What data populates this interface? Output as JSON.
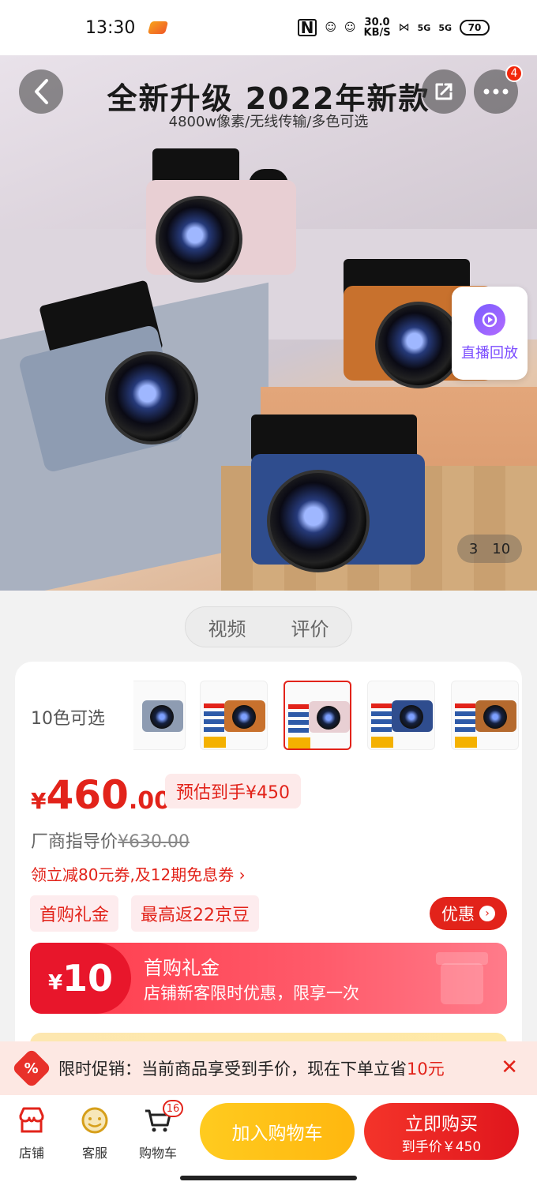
{
  "status_bar": {
    "time": "13:30",
    "nfc": "N",
    "net_speed_value": "30.0",
    "net_speed_unit": "KB/S",
    "signal1": "5G",
    "signal2": "5G",
    "battery": "70"
  },
  "hero": {
    "title": "全新升级  2022年新款",
    "subtitle": "4800w像素/无线传输/多色可选",
    "more_badge": "4",
    "live_replay_label": "直播回放",
    "pager_current": "3",
    "pager_total": "10"
  },
  "media_tabs": [
    "视频",
    "评价"
  ],
  "product": {
    "color_label": "10色可选",
    "price_currency": "¥",
    "price_int": "460",
    "price_dec": ".00",
    "estimate": "预估到手¥450",
    "msrp_label": "厂商指导价",
    "msrp_value": "¥630.00",
    "coupon_line": "领立减80元券,及12期免息券 ›",
    "chips": [
      "首购礼金",
      "最高返22京豆"
    ],
    "discount_button": "优惠"
  },
  "gift": {
    "currency": "¥",
    "amount": "10",
    "title": "首购礼金",
    "desc": "店铺新客限时优惠，限享一次"
  },
  "promo": {
    "icon_text": "%",
    "text_prefix": "限时促销：当前商品享受到手价，现在下单立省",
    "text_highlight": "10元",
    "close": "✕"
  },
  "bottom_bar": {
    "store_label": "店铺",
    "service_label": "客服",
    "cart_label": "购物车",
    "cart_count": "16",
    "add_cart_label": "加入购物车",
    "buy_now_label": "立即购买",
    "buy_now_sub": "到手价￥450"
  },
  "colors": {
    "accent_red": "#e2231a",
    "add_cart_yellow": "#ffb70f",
    "live_purple": "#7b4cff"
  },
  "icons": [
    "back-icon",
    "share-icon",
    "more-icon",
    "live-replay-icon",
    "store-icon",
    "service-icon",
    "cart-icon",
    "close-icon",
    "discount-icon"
  ]
}
